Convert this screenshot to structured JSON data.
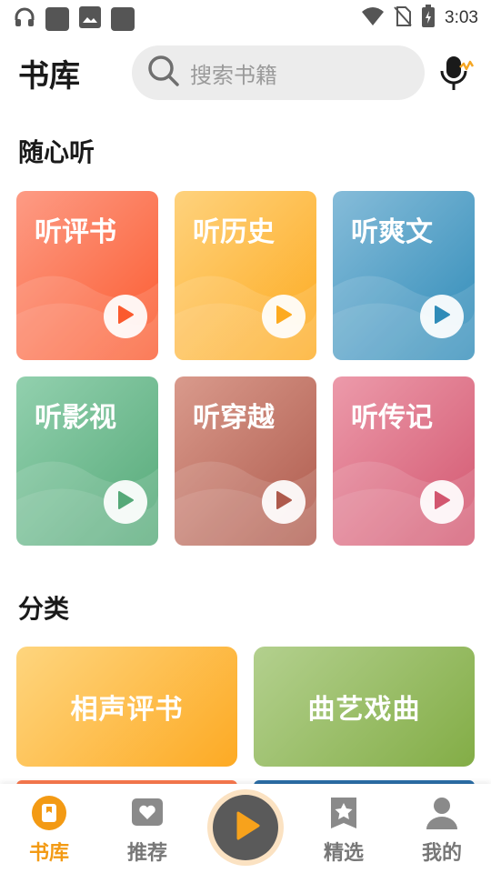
{
  "status_bar": {
    "time": "3:03",
    "left_icons": [
      "headphones-icon",
      "notification-square-icon",
      "image-icon",
      "notification-square-icon"
    ],
    "right_icons": [
      "wifi-icon",
      "no-sim-icon",
      "battery-charging-icon"
    ]
  },
  "header": {
    "title": "书库",
    "search_placeholder": "搜索书籍",
    "mic_icon": "voice-mic-icon"
  },
  "listen_section": {
    "title": "随心听",
    "cards": [
      {
        "label": "听评书",
        "color_from": "#fd9b85",
        "color_to": "#fb5a2e"
      },
      {
        "label": "听历史",
        "color_from": "#fed27d",
        "color_to": "#fdaa1f"
      },
      {
        "label": "听爽文",
        "color_from": "#86bcd9",
        "color_to": "#2f8bb8"
      },
      {
        "label": "听影视",
        "color_from": "#92d0ae",
        "color_to": "#55a978"
      },
      {
        "label": "听穿越",
        "color_from": "#d99a8c",
        "color_to": "#ae5a4c"
      },
      {
        "label": "听传记",
        "color_from": "#ec9aaa",
        "color_to": "#d2566f"
      }
    ]
  },
  "category_section": {
    "title": "分类",
    "cards": [
      {
        "label": "相声评书",
        "color_from": "#fed57e",
        "color_to": "#fdaa24"
      },
      {
        "label": "曲艺戏曲",
        "color_from": "#b3d08e",
        "color_to": "#83ad46"
      }
    ],
    "peek_colors": [
      "#fb7a4f",
      "#2c6fa8"
    ]
  },
  "bottom_nav": {
    "items": [
      {
        "label": "书库",
        "icon": "bookshelf-icon",
        "active": true
      },
      {
        "label": "推荐",
        "icon": "heart-icon",
        "active": false
      },
      {
        "label": "精选",
        "icon": "star-icon",
        "active": false
      },
      {
        "label": "我的",
        "icon": "user-icon",
        "active": false
      }
    ],
    "center_icon": "play-icon"
  },
  "colors": {
    "accent": "#f39a14",
    "inactive": "#777777"
  }
}
